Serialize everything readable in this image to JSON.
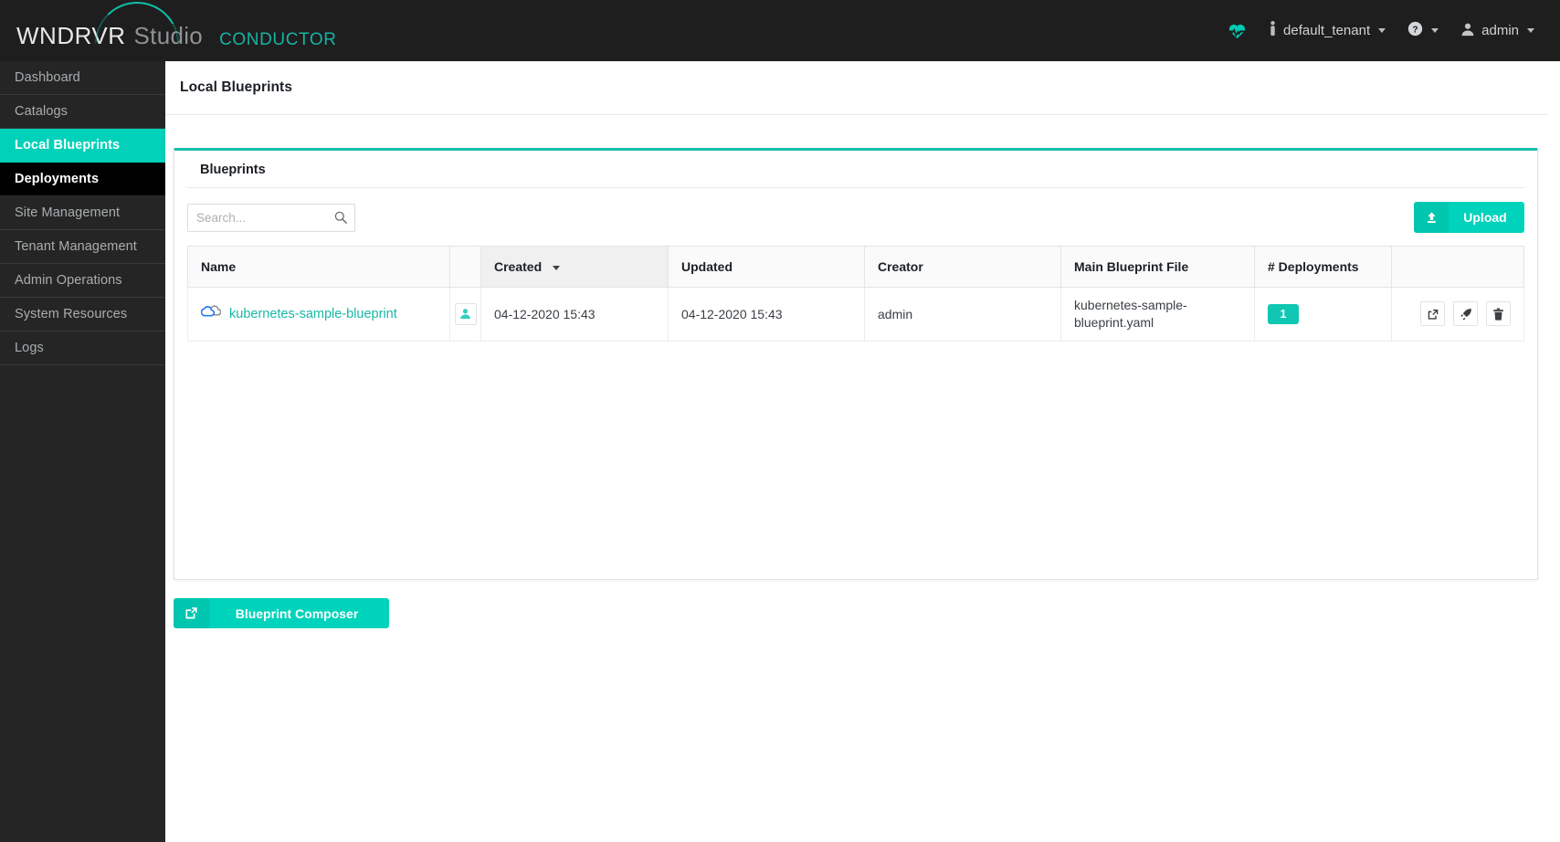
{
  "brand": {
    "word1": "WNDRVR",
    "word2": "Studio",
    "product": "CONDUCTOR"
  },
  "header": {
    "heartbeat_icon": "heartbeat-icon",
    "tenant_icon": "person-pin-icon",
    "tenant_label": "default_tenant",
    "help_icon": "question-circle-icon",
    "user_icon": "user-icon",
    "user_label": "admin"
  },
  "sidebar": {
    "items": [
      {
        "label": "Dashboard",
        "state": "normal"
      },
      {
        "label": "Catalogs",
        "state": "normal"
      },
      {
        "label": "Local Blueprints",
        "state": "active"
      },
      {
        "label": "Deployments",
        "state": "current"
      },
      {
        "label": "Site Management",
        "state": "normal"
      },
      {
        "label": "Tenant Management",
        "state": "normal"
      },
      {
        "label": "Admin Operations",
        "state": "normal"
      },
      {
        "label": "System Resources",
        "state": "normal"
      },
      {
        "label": "Logs",
        "state": "normal"
      }
    ]
  },
  "page": {
    "title": "Local Blueprints"
  },
  "panel": {
    "title": "Blueprints"
  },
  "search": {
    "placeholder": "Search...",
    "value": "",
    "icon": "search-icon"
  },
  "upload": {
    "label": "Upload",
    "icon": "upload-icon"
  },
  "composer": {
    "label": "Blueprint Composer",
    "icon": "external-link-icon"
  },
  "table": {
    "columns": [
      {
        "label": "Name",
        "sorted": false
      },
      {
        "label": "",
        "sorted": false
      },
      {
        "label": "Created",
        "sorted": true
      },
      {
        "label": "Updated",
        "sorted": false
      },
      {
        "label": "Creator",
        "sorted": false
      },
      {
        "label": "Main Blueprint File",
        "sorted": false
      },
      {
        "label": "# Deployments",
        "sorted": false
      },
      {
        "label": "",
        "sorted": false
      }
    ],
    "rows": [
      {
        "icon": "cloud-icon",
        "name": "kubernetes-sample-blueprint",
        "owner_icon": "person-icon",
        "created": "04-12-2020 15:43",
        "updated": "04-12-2020 15:43",
        "creator": "admin",
        "main_file": "kubernetes-sample-blueprint.yaml",
        "deployments": "1",
        "actions": [
          {
            "name": "share-icon"
          },
          {
            "name": "rocket-icon"
          },
          {
            "name": "trash-icon"
          }
        ]
      }
    ]
  },
  "colors": {
    "accent": "#00d3bb",
    "panel_top_border": "#17c0ac",
    "sidebar_active": "#00d1b8",
    "sidebar_current": "#000000",
    "link": "#19b8a6",
    "header_bg": "#1e1e1e",
    "sidebar_bg": "#252525",
    "brand_conductor": "#17b3a3"
  }
}
